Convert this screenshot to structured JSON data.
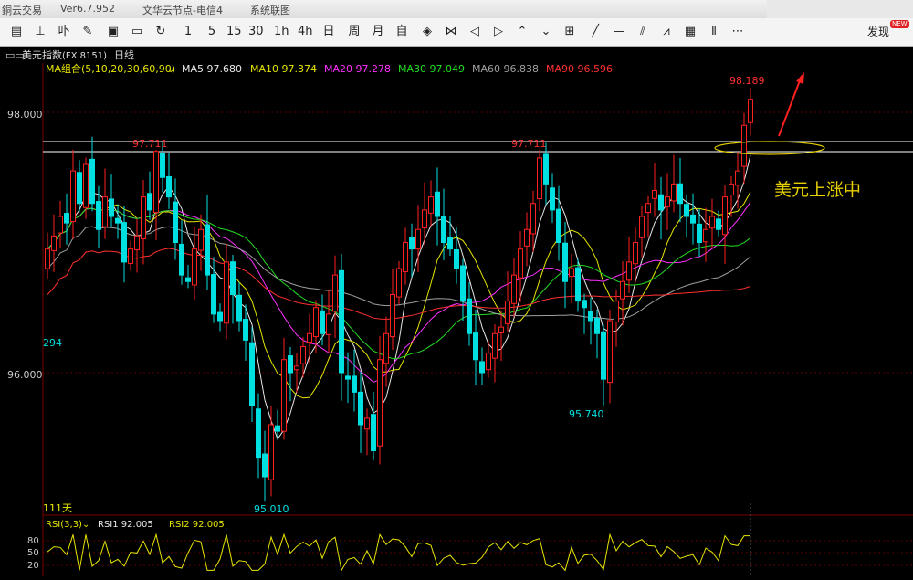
{
  "titlebar": {
    "app": "銅云交易",
    "version": "Ver6.7.952",
    "node": "文华云节点-电信4",
    "menu": "系统联图"
  },
  "toolbar": {
    "buttons": [
      {
        "name": "table-view-icon",
        "label": "▤"
      },
      {
        "name": "candle-icon",
        "label": "⊥"
      },
      {
        "name": "split-icon",
        "label": "卟"
      },
      {
        "name": "draw-icon",
        "label": "✎"
      },
      {
        "name": "screen-icon",
        "label": "▣"
      },
      {
        "name": "save-icon",
        "label": "▭"
      },
      {
        "name": "refresh-icon",
        "label": "↻"
      },
      {
        "name": "period-1",
        "label": "1"
      },
      {
        "name": "period-5",
        "label": "5"
      },
      {
        "name": "period-15",
        "label": "15"
      },
      {
        "name": "period-30",
        "label": "30"
      },
      {
        "name": "period-1h",
        "label": "1h"
      },
      {
        "name": "period-4h",
        "label": "4h"
      },
      {
        "name": "period-day",
        "label": "日"
      },
      {
        "name": "period-week",
        "label": "周"
      },
      {
        "name": "period-month",
        "label": "月"
      },
      {
        "name": "period-custom",
        "label": "自"
      },
      {
        "name": "zoom-in-icon",
        "label": "◈"
      },
      {
        "name": "zoom-out-icon",
        "label": "⋈"
      },
      {
        "name": "left-icon",
        "label": "◁"
      },
      {
        "name": "right-icon",
        "label": "▷"
      },
      {
        "name": "up-icon",
        "label": "⌃"
      },
      {
        "name": "down-icon",
        "label": "⌄"
      },
      {
        "name": "layout-icon",
        "label": "⊞"
      },
      {
        "name": "line-icon",
        "label": "╱"
      },
      {
        "name": "hline-icon",
        "label": "—"
      },
      {
        "name": "parallel-icon",
        "label": "⫽"
      },
      {
        "name": "fib-icon",
        "label": "⩘"
      },
      {
        "name": "grid-icon",
        "label": "▦"
      },
      {
        "name": "bars-icon",
        "label": "⦀"
      },
      {
        "name": "more-icon",
        "label": "⋯"
      }
    ],
    "discover": "发现",
    "new_badge": "NEW"
  },
  "chart": {
    "symbol": "美元指数",
    "code": "(FX 8151)",
    "period": "日线",
    "ma_group": "MA组合(5,10,20,30,60,90)",
    "ma": [
      {
        "label": "MA5 97.680",
        "color": "#e8e8e8"
      },
      {
        "label": "MA10 97.374",
        "color": "#e6e600"
      },
      {
        "label": "MA20 97.278",
        "color": "#ff30ff"
      },
      {
        "label": "MA30 97.049",
        "color": "#22dd22"
      },
      {
        "label": "MA60 96.838",
        "color": "#a0a0a0"
      },
      {
        "label": "MA90 96.596",
        "color": "#ff3030"
      }
    ],
    "y_label_high": "98.000",
    "y_label_low": "96.000",
    "left_edge_label": "294",
    "days_label": "111天",
    "annotations": {
      "high1": "97.711",
      "high2": "97.711",
      "last_high": "98.189",
      "low1": "95.010",
      "low2": "95.740"
    },
    "callout": "美元上涨中",
    "up_color": "#ff2020",
    "down_color": "#00e0e0",
    "rsi": {
      "title": "RSI(3,3)",
      "rsi1": "RSI1 92.005",
      "rsi2": "RSI2 92.005",
      "ticks": [
        "80",
        "50",
        "20"
      ]
    }
  },
  "chart_data": {
    "type": "candlestick",
    "title": "美元指数(FX 8151) 日线",
    "ylim": [
      95.0,
      98.4
    ],
    "yticks": [
      96.0,
      98.0
    ],
    "closes": [
      96.95,
      97.05,
      97.2,
      97.15,
      97.55,
      97.3,
      97.6,
      97.3,
      97.1,
      97.35,
      97.2,
      97.15,
      96.85,
      96.95,
      97.05,
      97.35,
      97.25,
      97.7,
      97.5,
      97.35,
      97.0,
      96.75,
      96.7,
      96.95,
      97.1,
      96.75,
      96.45,
      96.4,
      96.85,
      96.6,
      96.4,
      96.25,
      95.75,
      95.35,
      95.2,
      95.6,
      95.55,
      96.1,
      96.0,
      96.05,
      96.2,
      96.3,
      96.5,
      96.3,
      96.45,
      96.75,
      96.0,
      95.95,
      95.85,
      95.6,
      95.65,
      95.4,
      96.1,
      96.3,
      96.6,
      96.8,
      97.0,
      96.95,
      97.1,
      97.25,
      97.35,
      97.2,
      97.0,
      96.95,
      96.8,
      96.55,
      96.3,
      96.1,
      96.0,
      96.15,
      96.3,
      96.35,
      96.55,
      96.75,
      96.95,
      97.1,
      97.3,
      97.65,
      97.45,
      97.25,
      97.0,
      96.7,
      96.8,
      96.55,
      96.5,
      96.4,
      96.3,
      95.95,
      96.4,
      96.55,
      96.7,
      96.85,
      97.0,
      97.2,
      97.3,
      97.4,
      97.25,
      97.35,
      97.45,
      97.3,
      97.2,
      97.15,
      97.0,
      97.1,
      97.2,
      97.1,
      97.35,
      97.45,
      97.55,
      97.9,
      98.1
    ],
    "marked_high": 97.711,
    "marked_low": 95.01,
    "last_high": 98.189,
    "rsi_ylim": [
      0,
      100
    ],
    "rsi_ticks": [
      20,
      50,
      80
    ]
  }
}
